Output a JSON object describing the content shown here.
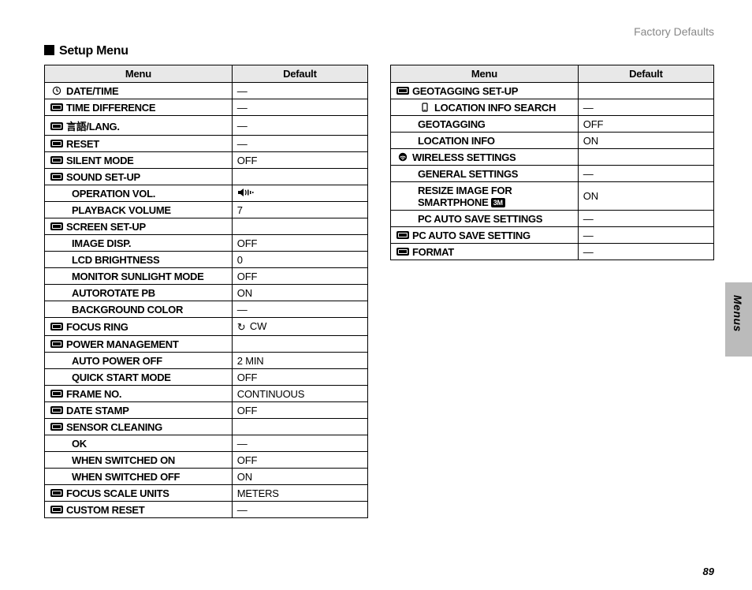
{
  "header": {
    "right": "Factory Defaults"
  },
  "title": "Setup Menu",
  "section_label": "Menus",
  "page_number": "89",
  "table_headers": {
    "menu": "Menu",
    "default": "Default"
  },
  "left": [
    {
      "type": "top",
      "icon": "clock-icon",
      "label": "DATE/TIME",
      "default": "—"
    },
    {
      "type": "top",
      "icon": "time-diff-icon",
      "label": "TIME DIFFERENCE",
      "default": "—"
    },
    {
      "type": "top",
      "icon": "lang-icon",
      "label": "言語/LANG.",
      "default": "—"
    },
    {
      "type": "top",
      "icon": "reset-icon",
      "label": "RESET",
      "default": "—"
    },
    {
      "type": "top",
      "icon": "silent-icon",
      "label": "SILENT MODE",
      "default": "OFF"
    },
    {
      "type": "top",
      "icon": "sound-icon",
      "label": "SOUND SET-UP",
      "default": ""
    },
    {
      "type": "sub",
      "label": "OPERATION VOL.",
      "default": "SPKR"
    },
    {
      "type": "sub",
      "label": "PLAYBACK VOLUME",
      "default": "7"
    },
    {
      "type": "top",
      "icon": "screen-icon",
      "label": "SCREEN SET-UP",
      "default": ""
    },
    {
      "type": "sub",
      "label": "IMAGE DISP.",
      "default": "OFF"
    },
    {
      "type": "sub",
      "label": "LCD BRIGHTNESS",
      "default": "0"
    },
    {
      "type": "sub",
      "label": "MONITOR SUNLIGHT MODE",
      "default": "OFF"
    },
    {
      "type": "sub",
      "label": "AUTOROTATE PB",
      "default": "ON"
    },
    {
      "type": "sub",
      "label": "BACKGROUND COLOR",
      "default": "—"
    },
    {
      "type": "top",
      "icon": "focus-ring-icon",
      "label": "FOCUS RING",
      "default": "CW",
      "default_icon": "rotate-icon"
    },
    {
      "type": "top",
      "icon": "power-icon",
      "label": "POWER MANAGEMENT",
      "default": ""
    },
    {
      "type": "sub",
      "label": "AUTO POWER OFF",
      "default": "2 MIN"
    },
    {
      "type": "sub",
      "label": "QUICK START MODE",
      "default": "OFF"
    },
    {
      "type": "top",
      "icon": "frame-icon",
      "label": "FRAME NO.",
      "default": "CONTINUOUS"
    },
    {
      "type": "top",
      "icon": "date-stamp-icon",
      "label": "DATE STAMP",
      "default": "OFF"
    },
    {
      "type": "top",
      "icon": "sensor-icon",
      "label": "SENSOR CLEANING",
      "default": ""
    },
    {
      "type": "sub",
      "label": "OK",
      "default": "—"
    },
    {
      "type": "sub",
      "label": "WHEN SWITCHED ON",
      "default": "OFF"
    },
    {
      "type": "sub",
      "label": "WHEN SWITCHED OFF",
      "default": "ON"
    },
    {
      "type": "top",
      "icon": "scale-icon",
      "label": "FOCUS SCALE UNITS",
      "default": "METERS"
    },
    {
      "type": "top",
      "icon": "custom-icon",
      "label": "CUSTOM RESET",
      "default": "—"
    }
  ],
  "right": [
    {
      "type": "top",
      "icon": "geo-icon",
      "label": "GEOTAGGING SET-UP",
      "default": ""
    },
    {
      "type": "sub",
      "icon": "phone-icon",
      "label": "LOCATION INFO SEARCH",
      "default": "—"
    },
    {
      "type": "sub",
      "label": "GEOTAGGING",
      "default": "OFF"
    },
    {
      "type": "sub",
      "label": "LOCATION INFO",
      "default": "ON"
    },
    {
      "type": "top",
      "icon": "wifi-icon",
      "label": "WIRELESS SETTINGS",
      "default": ""
    },
    {
      "type": "sub",
      "label": "GENERAL SETTINGS",
      "default": "—"
    },
    {
      "type": "sub",
      "label": "RESIZE IMAGE FOR SMARTPHONE",
      "chip": "3M",
      "default": "ON"
    },
    {
      "type": "sub",
      "label": "PC AUTO SAVE SETTINGS",
      "default": "—"
    },
    {
      "type": "top",
      "icon": "pc-icon",
      "label": "PC AUTO SAVE SETTING",
      "default": "—"
    },
    {
      "type": "top",
      "icon": "format-icon",
      "label": "FORMAT",
      "default": "—"
    }
  ]
}
